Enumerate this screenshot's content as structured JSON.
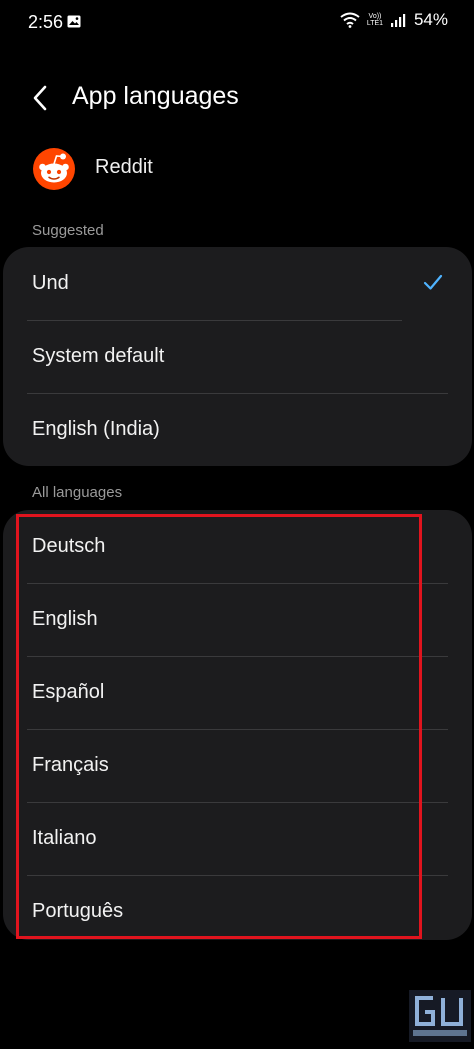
{
  "status_bar": {
    "time": "2:56",
    "network_label": "Vo)) LTE1",
    "battery": "54%"
  },
  "header": {
    "title": "App languages"
  },
  "app": {
    "name": "Reddit"
  },
  "suggested": {
    "label": "Suggested",
    "items": [
      {
        "label": "Und",
        "selected": true
      },
      {
        "label": "System default",
        "selected": false
      },
      {
        "label": "English (India)",
        "selected": false
      }
    ]
  },
  "all_languages": {
    "label": "All languages",
    "items": [
      {
        "label": "Deutsch"
      },
      {
        "label": "English"
      },
      {
        "label": "Español"
      },
      {
        "label": "Français"
      },
      {
        "label": "Italiano"
      },
      {
        "label": "Português"
      }
    ]
  },
  "colors": {
    "accent": "#4fb3ff",
    "highlight": "#e0141e",
    "card": "#1c1c1e",
    "reddit": "#ff4500"
  },
  "icons": [
    "gallery-icon",
    "wifi-icon",
    "signal-icon",
    "back-icon",
    "reddit-logo-icon",
    "check-icon"
  ]
}
